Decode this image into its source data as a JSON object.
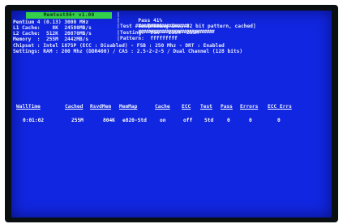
{
  "header": {
    "title": "Memtest86+ v1.00"
  },
  "left_info": [
    "Pentium 4 (0.13) 3000 MHz",
    "L1 Cache:    8K  24580MB/s",
    "L2 Cache:  512K  20870MB/s",
    "Memory  :  255M  2442MB/s",
    "Chipset : Intel i875P (ECC : Disabled) - FSB : 250 Mhz - DRT : Enabled",
    "Settings: RAM : 200 Mhz (DDR400) / CAS : 2.5-2-2-5 / Dual Channel (128 bits)"
  ],
  "right_info": {
    "pass_label": "Pass 41%",
    "pass_bar": "####################",
    "test_label": "Test 79%",
    "test_bar": "##############################",
    "test_desc": "Test #4  [Moving inv, 32 bit pattern, cached]",
    "testing": "Testing:  96K - 255M  255M",
    "pattern": "Pattern:  fffffffff"
  },
  "table": {
    "headers": [
      "WallTime",
      "Cached",
      "RsvdMem",
      "MemMap",
      "Cache",
      "ECC",
      "Test",
      "Pass",
      "Errors",
      "ECC Errs"
    ],
    "row": [
      "0:01:02",
      "255M",
      "804K",
      "e820-Std",
      "on",
      "off",
      "Std",
      "0",
      "0",
      "0"
    ]
  },
  "colors": {
    "background": "#1126e0",
    "title_bar": "#34d04a",
    "text": "#e8ecff"
  }
}
